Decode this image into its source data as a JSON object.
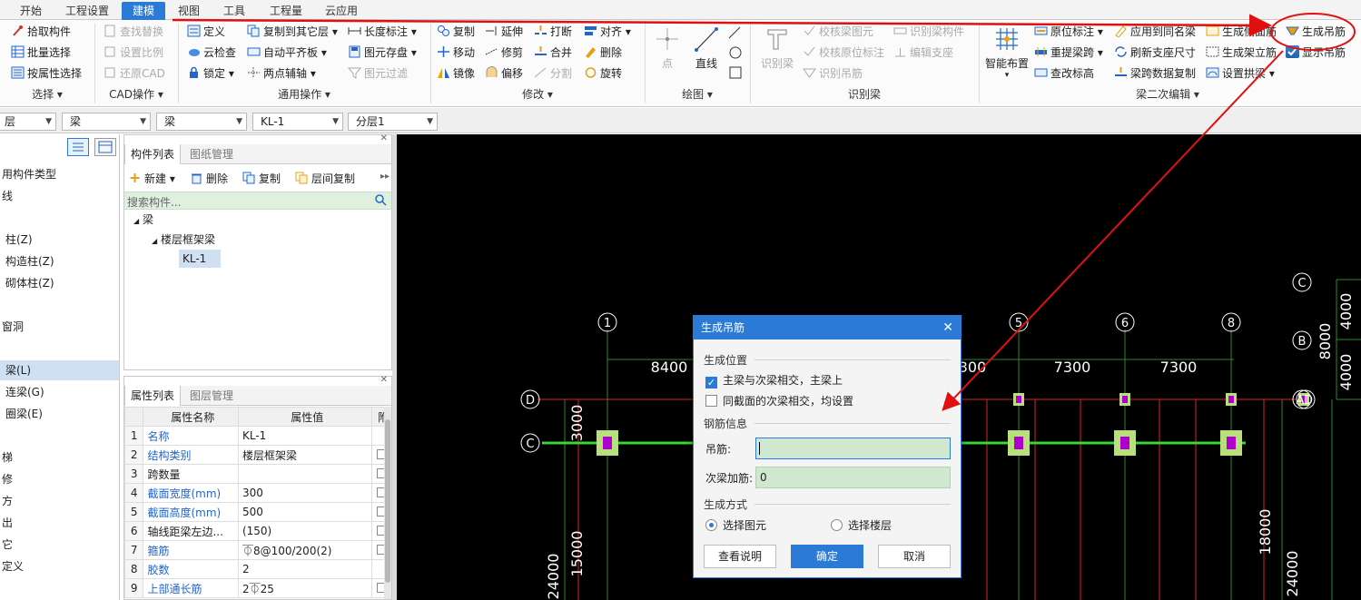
{
  "menu_tabs": [
    "开始",
    "工程设置",
    "建模",
    "视图",
    "工具",
    "工程量",
    "云应用"
  ],
  "ribbon": {
    "select_group": {
      "items": [
        "拾取构件",
        "批量选择",
        "按属性选择"
      ],
      "title": "选择"
    },
    "cad_group": {
      "items": [
        "查找替换",
        "设置比例",
        "还原CAD"
      ],
      "title": "CAD操作"
    },
    "common_group": {
      "col1": [
        "定义",
        "云检查",
        "锁定"
      ],
      "col2": [
        "复制到其它层",
        "自动平齐板",
        "两点辅轴"
      ],
      "col3": [
        "长度标注",
        "图元存盘",
        "图元过滤"
      ],
      "title": "通用操作"
    },
    "modify_group": {
      "col1": [
        "复制",
        "移动",
        "镜像"
      ],
      "col2": [
        "延伸",
        "修剪",
        "偏移"
      ],
      "col3": [
        "打断",
        "合并",
        "分割"
      ],
      "col4": [
        "对齐",
        "删除",
        "旋转"
      ],
      "title": "修改"
    },
    "draw_group": {
      "point": "点",
      "line": "直线",
      "title": "绘图"
    },
    "identify_group": {
      "big": "识别梁",
      "col1": [
        "校核梁图元",
        "校核原位标注",
        "识别吊筋"
      ],
      "col2": [
        "识别梁构件",
        "编辑支座"
      ],
      "title": "识别梁"
    },
    "beam_edit_group": {
      "big": "智能布置",
      "col1": [
        "原位标注",
        "重提梁跨",
        "查改标高"
      ],
      "col2": [
        "应用到同名梁",
        "刷新支座尺寸",
        "梁跨数据复制"
      ],
      "col3": [
        "生成侧面筋",
        "生成架立筋",
        "设置拱梁"
      ],
      "col4": [
        "生成吊筋",
        "显示吊筋"
      ],
      "title": "梁二次编辑"
    }
  },
  "filters": [
    "层",
    "梁",
    "梁",
    "KL-1",
    "分层1"
  ],
  "left_tree": [
    "用构件类型",
    "线",
    "柱(Z)",
    "构造柱(Z)",
    "砌体柱(Z)",
    "窗洞",
    "梁(L)",
    "连梁(G)",
    "圈梁(E)",
    "梯",
    "修",
    "方",
    "出",
    "它",
    "定义"
  ],
  "comp_panel": {
    "tabs": [
      "构件列表",
      "图纸管理"
    ],
    "toolbar": [
      "新建",
      "删除",
      "复制",
      "层间复制"
    ],
    "search_placeholder": "搜索构件...",
    "tree": {
      "root": "梁",
      "child": "楼层框架梁",
      "leaf": "KL-1"
    }
  },
  "prop_panel": {
    "tabs": [
      "属性列表",
      "图层管理"
    ],
    "headers": [
      "属性名称",
      "属性值",
      "附"
    ],
    "rows": [
      {
        "no": "1",
        "name": "名称",
        "value": "KL-1",
        "blue": true,
        "chk": false
      },
      {
        "no": "2",
        "name": "结构类别",
        "value": "楼层框架梁",
        "blue": true,
        "chk": true
      },
      {
        "no": "3",
        "name": "跨数量",
        "value": "",
        "blue": false,
        "chk": true
      },
      {
        "no": "4",
        "name": "截面宽度(mm)",
        "value": "300",
        "blue": true,
        "chk": true
      },
      {
        "no": "5",
        "name": "截面高度(mm)",
        "value": "500",
        "blue": true,
        "chk": true
      },
      {
        "no": "6",
        "name": "轴线距梁左边...",
        "value": "(150)",
        "blue": false,
        "chk": true
      },
      {
        "no": "7",
        "name": "箍筋",
        "value": "⏁8@100/200(2)",
        "blue": true,
        "chk": true
      },
      {
        "no": "8",
        "name": "胶数",
        "value": "2",
        "blue": true,
        "chk": false
      },
      {
        "no": "9",
        "name": "上部通长筋",
        "value": "2⏁25",
        "blue": true,
        "chk": true
      }
    ]
  },
  "canvas": {
    "axis_top": [
      "1",
      "5",
      "6",
      "8"
    ],
    "axis_left": [
      "D",
      "C"
    ],
    "axis_right": [
      "C",
      "B",
      "A",
      "D"
    ],
    "dims_top": [
      "8400",
      "300",
      "7300",
      "7300"
    ],
    "dims_right": [
      "4000",
      "8000",
      "4000"
    ],
    "dims_vertical": [
      "3000",
      "15000",
      "24000",
      "18000",
      "24000"
    ]
  },
  "dialog": {
    "title": "生成吊筋",
    "section_position": "生成位置",
    "opt_main": "主梁与次梁相交，主梁上",
    "opt_same": "同截面的次梁相交，均设置",
    "section_rebar": "钢筋信息",
    "label_hanger": "吊筋:",
    "hanger_value": "",
    "label_secondary": "次梁加筋:",
    "secondary_value": "0",
    "section_mode": "生成方式",
    "radio_element": "选择图元",
    "radio_floor": "选择楼层",
    "btn_help": "查看说明",
    "btn_ok": "确定",
    "btn_cancel": "取消"
  }
}
